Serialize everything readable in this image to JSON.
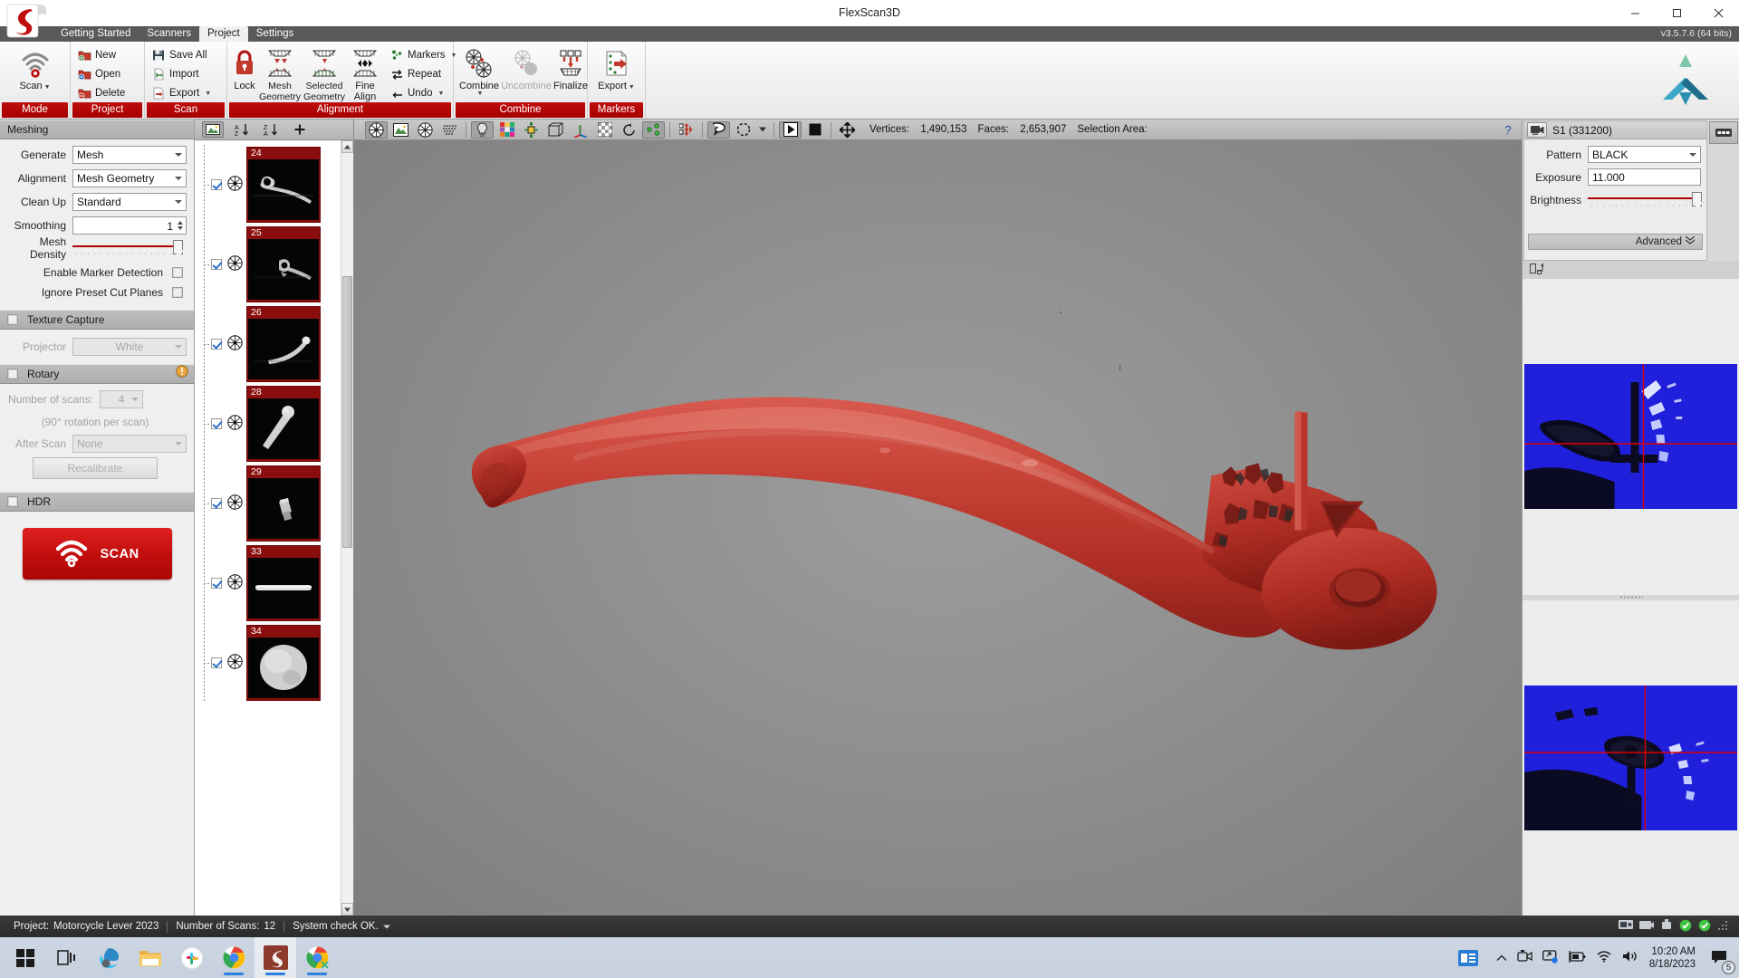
{
  "window": {
    "title": "FlexScan3D",
    "version": "v3.5.7.6  (64 bits)",
    "minimize": "─",
    "maximize": "❐",
    "close": "✕"
  },
  "menu": {
    "tabs": [
      {
        "label": "Getting Started",
        "active": false
      },
      {
        "label": "Scanners",
        "active": false
      },
      {
        "label": "Project",
        "active": true
      },
      {
        "label": "Settings",
        "active": false
      }
    ]
  },
  "ribbon": {
    "groups": [
      {
        "title": "Mode",
        "items": [
          {
            "label": "Scan",
            "dropdown": true
          }
        ]
      },
      {
        "title": "Project",
        "items": [
          {
            "label": "New"
          },
          {
            "label": "Open"
          },
          {
            "label": "Delete"
          }
        ]
      },
      {
        "title": "Scan",
        "items": [
          {
            "label": "Save All"
          },
          {
            "label": "Import"
          },
          {
            "label": "Export",
            "dropdown": true
          }
        ]
      },
      {
        "title": "Alignment",
        "items": [
          {
            "label": "Lock"
          },
          {
            "label": "Mesh Geometry"
          },
          {
            "label": "Selected Geometry"
          },
          {
            "label": "Fine Align"
          },
          {
            "label": "Markers",
            "dropdown": true
          },
          {
            "label": "Repeat"
          },
          {
            "label": "Undo",
            "dropdown": true
          }
        ]
      },
      {
        "title": "Combine",
        "items": [
          {
            "label": "Combine",
            "dropdown": true
          },
          {
            "label": "Uncombine",
            "disabled": true
          },
          {
            "label": "Finalize"
          }
        ]
      },
      {
        "title": "Markers",
        "items": [
          {
            "label": "Export",
            "dropdown": true
          }
        ]
      }
    ]
  },
  "left_panel": {
    "meshing": {
      "header": "Meshing",
      "generate_label": "Generate",
      "generate_value": "Mesh",
      "alignment_label": "Alignment",
      "alignment_value": "Mesh Geometry",
      "cleanup_label": "Clean Up",
      "cleanup_value": "Standard",
      "smoothing_label": "Smoothing",
      "smoothing_value": "1",
      "mesh_density_label": "Mesh Density",
      "mesh_density_percent": 93,
      "enable_marker_detection_label": "Enable Marker Detection",
      "enable_marker_detection_checked": false,
      "ignore_preset_cut_planes_label": "Ignore Preset Cut Planes",
      "ignore_preset_cut_planes_checked": false
    },
    "texture_capture": {
      "header": "Texture Capture",
      "checked": false,
      "projector_label": "Projector",
      "projector_value": "White"
    },
    "rotary": {
      "header": "Rotary",
      "checked": false,
      "number_of_scans_label": "Number of scans:",
      "number_of_scans_value": "4",
      "rotation_note": "(90° rotation per scan)",
      "after_scan_label": "After Scan",
      "after_scan_value": "None",
      "recalibrate_label": "Recalibrate"
    },
    "hdr": {
      "header": "HDR",
      "checked": false
    },
    "scan_button_label": "SCAN"
  },
  "scan_list": {
    "toolbar": {
      "thumbnail_view": "thumbnail-view",
      "sort_az": "A↓",
      "sort_za": "Z↓",
      "add": "+"
    },
    "items": [
      {
        "number": "24",
        "checked": true,
        "shape": "lever-side"
      },
      {
        "number": "25",
        "checked": true,
        "shape": "lever-pivot"
      },
      {
        "number": "26",
        "checked": true,
        "shape": "lever-curve"
      },
      {
        "number": "28",
        "checked": true,
        "shape": "lever-tip"
      },
      {
        "number": "29",
        "checked": true,
        "shape": "fragment"
      },
      {
        "number": "33",
        "checked": true,
        "shape": "bar"
      },
      {
        "number": "34",
        "checked": true,
        "shape": "blob"
      }
    ]
  },
  "viewport_toolbar": {
    "buttons": [
      {
        "name": "mesh-shaded-icon",
        "active": true
      },
      {
        "name": "textured-mesh-icon",
        "active": false
      },
      {
        "name": "wireframe-icon",
        "active": false
      },
      {
        "name": "point-cloud-icon",
        "active": false
      },
      {
        "name": "light-bulb-icon",
        "active": true
      },
      {
        "name": "color-palette-icon",
        "active": false
      },
      {
        "name": "axis-gizmo-icon",
        "active": false
      },
      {
        "name": "bounding-box-icon",
        "active": false
      },
      {
        "name": "coordinate-axes-icon",
        "active": false
      },
      {
        "name": "checkerboard-icon",
        "active": false
      },
      {
        "name": "reset-rotation-icon",
        "active": false
      },
      {
        "name": "markers-icon",
        "active": true
      },
      {
        "name": "clipping-icon",
        "active": false
      },
      {
        "name": "lasso-select-icon",
        "active": true
      },
      {
        "name": "circle-select-icon",
        "active": false
      },
      {
        "name": "play-icon",
        "active": true
      },
      {
        "name": "stop-icon",
        "active": false
      },
      {
        "name": "pan-move-icon",
        "active": false
      }
    ],
    "vertices_label": "Vertices:",
    "vertices_value": "1,490,153",
    "faces_label": "Faces:",
    "faces_value": "2,653,907",
    "selection_area_label": "Selection Area:",
    "selection_area_value": "",
    "help": "?"
  },
  "right_panel": {
    "scanner_title": "S1 (331200)",
    "pattern_label": "Pattern",
    "pattern_value": "BLACK",
    "exposure_label": "Exposure",
    "exposure_value": "11.000",
    "brightness_label": "Brightness",
    "brightness_percent": 96,
    "advanced_label": "Advanced"
  },
  "status_bar": {
    "project_label": "Project:",
    "project_value": "Motorcycle Lever 2023",
    "scans_label": "Number of Scans:",
    "scans_value": "12",
    "system_check": "System check OK."
  },
  "taskbar": {
    "start": "start-icon",
    "items": [
      "task-view-icon",
      "edge-icon",
      "file-explorer-icon",
      "slack-icon",
      "chrome-icon",
      "flexscan3d-icon",
      "chrome-icon-2"
    ],
    "tray": [
      "show-hidden-icon",
      "camera-icon",
      "screen-share-icon",
      "battery-icon",
      "wifi-icon",
      "volume-icon"
    ],
    "time": "10:20 AM",
    "date": "8/18/2023",
    "notification_count": "5"
  },
  "colors": {
    "accent_red": "#c00d0d",
    "ribbon_title_red": "#a60000",
    "model_red": "#c0392b",
    "taskbar": "#c6d0de"
  }
}
